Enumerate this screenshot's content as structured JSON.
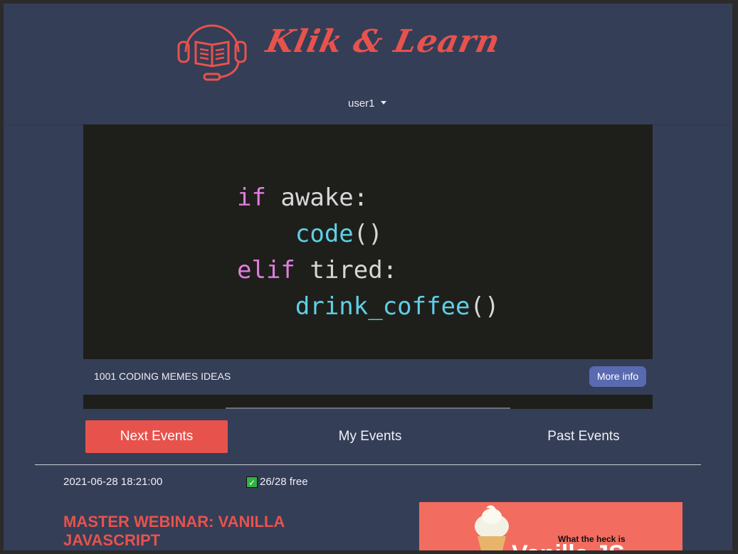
{
  "brand": {
    "name": "Klik & Learn",
    "logo_icon": "headset-book-icon",
    "accent": "#e8524d"
  },
  "user_menu": {
    "label": "user1"
  },
  "carousel": {
    "code": {
      "line1_kw": "if",
      "line1_rest": " awake:",
      "line2_fn": "code",
      "line2_rest": "()",
      "line3_kw": "elif",
      "line3_rest": " tired:",
      "line4_fn": "drink_coffee",
      "line4_rest": "()"
    },
    "caption": "1001 CODING MEMES IDEAS",
    "more_info": "More info"
  },
  "tabs": [
    {
      "label": "Next Events",
      "active": true
    },
    {
      "label": "My Events",
      "active": false
    },
    {
      "label": "Past Events",
      "active": false
    }
  ],
  "event": {
    "date": "2021-06-28 18:21:00",
    "free": "26/28 free",
    "title": "MASTER WEBINAR: VANILLA JAVASCRIPT",
    "thumb_caption": "What the heck is",
    "thumb_big": "Vanilla JS"
  }
}
